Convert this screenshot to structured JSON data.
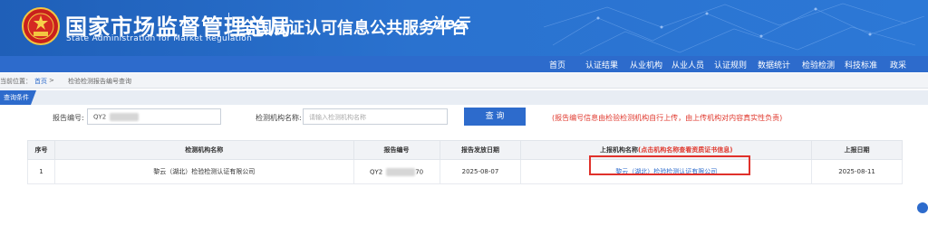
{
  "header": {
    "org_cn": "国家市场监督管理总局",
    "org_en": "State Administration  for  Market Regulation",
    "platform": "全国认证认可信息公共服务平台",
    "logo_text": "认e云"
  },
  "nav": {
    "items": [
      "首页",
      "认证结果",
      "从业机构",
      "从业人员",
      "认证规则",
      "数据统计",
      "检验检测",
      "科技标准",
      "政采"
    ]
  },
  "breadcrumb": {
    "label": "当前位置：",
    "home": "首页",
    "separator": ">",
    "current": "检验检测报告编号查询"
  },
  "query": {
    "tab_label": "查询条件",
    "report_no_label": "报告编号:",
    "report_no_value": "QY2",
    "org_name_label": "检测机构名称:",
    "org_name_placeholder": "请输入检测机构名称",
    "query_button": "查 询",
    "notice": "(报告编号信息由检验检测机构自行上传，由上传机构对内容真实性负责)"
  },
  "table": {
    "headers": {
      "seq": "序号",
      "org_name": "检测机构名称",
      "report_no": "报告编号",
      "issue_date": "报告发放日期",
      "uploader_prefix": "上报机构名称",
      "uploader_note": "(点击机构名称查看资质证书信息)",
      "upload_date": "上报日期"
    },
    "rows": [
      {
        "seq": "1",
        "org_name": "黎云（湖北）检验检测认证有限公司",
        "report_no_prefix": "QY2",
        "report_no_suffix": "70",
        "issue_date": "2025-08-07",
        "uploader": "黎云（湖北）检验检测认证有限公司",
        "upload_date": "2025-08-11"
      }
    ]
  },
  "colors": {
    "brand_blue": "#2d6bcc",
    "notice_red": "#e03a2f",
    "highlight_red": "#e0312b"
  },
  "icons": {
    "emblem": "national-emblem-icon"
  }
}
